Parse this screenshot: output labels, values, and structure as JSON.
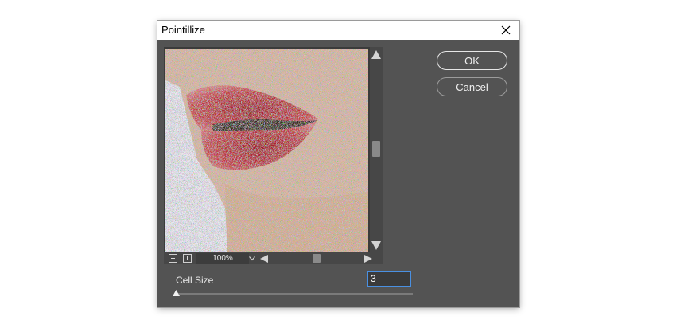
{
  "dialog": {
    "title": "Pointillize",
    "close_icon": "close-icon"
  },
  "preview": {
    "image_description_icon": "preview-image",
    "zoom_value": "100%",
    "zoom_out_icon": "minus-icon",
    "zoom_in_icon": "plus-icon",
    "dropdown_icon": "chevron-down-icon"
  },
  "buttons": {
    "ok_label": "OK",
    "cancel_label": "Cancel"
  },
  "controls": {
    "cell_size_label": "Cell Size",
    "cell_size_value": "3",
    "slider_fraction": 0.0
  },
  "colors": {
    "dialog_bg": "#535353",
    "accent": "#4a90e2"
  }
}
